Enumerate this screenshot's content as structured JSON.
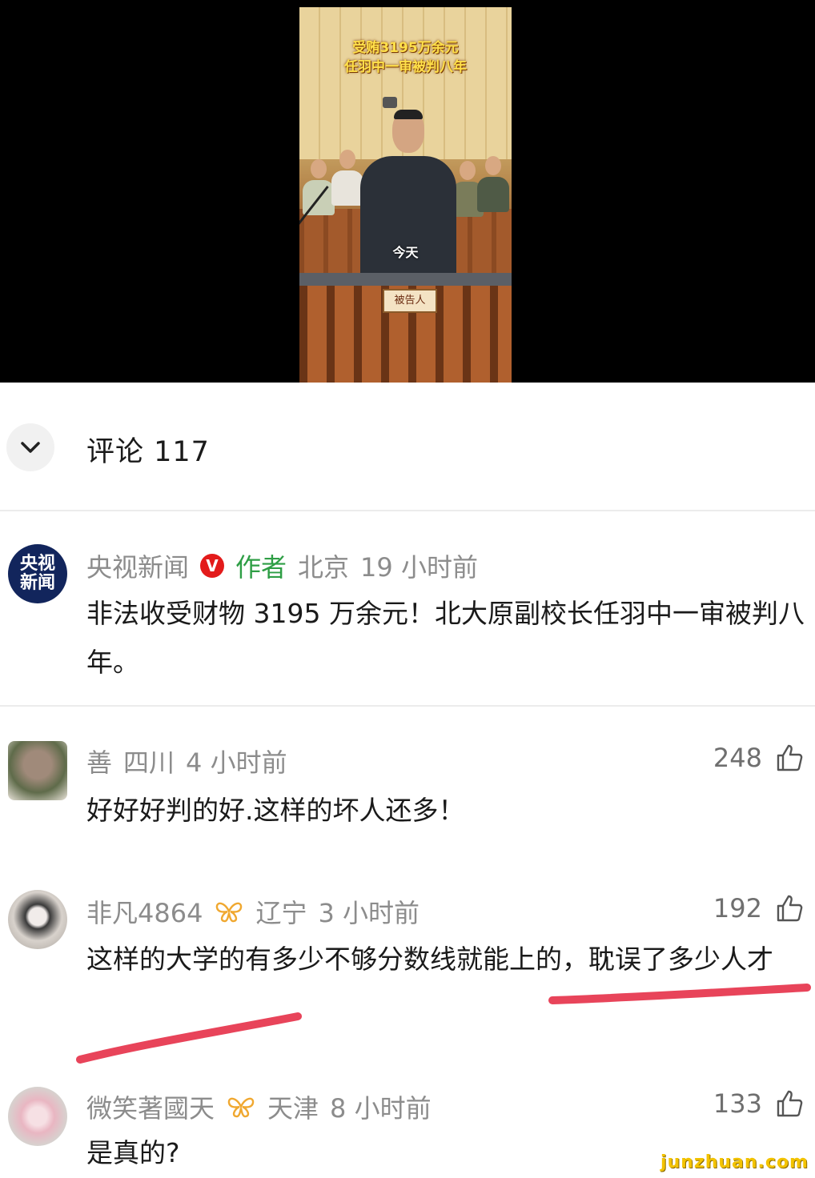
{
  "video": {
    "title_line1": "受贿3195万余元",
    "title_line2": "任羽中一审被判八年",
    "subtitle": "今天",
    "plaque": "被告人"
  },
  "comments_header": {
    "title": "评论 117"
  },
  "post": {
    "author": "央视新闻",
    "avatar_text_top": "央视",
    "avatar_text_bottom": "新闻",
    "verified_badge": "V",
    "author_tag": "作者",
    "location": "北京",
    "time": "19 小时前",
    "text": "非法收受财物 3195 万余元！北大原副校长任羽中一审被判八年。"
  },
  "comments": [
    {
      "user": "善",
      "location": "四川",
      "time": "4 小时前",
      "likes": "248",
      "text": "好好好判的好.这样的坏人还多！"
    },
    {
      "user": "非凡4864",
      "location": "辽宁",
      "time": "3 小时前",
      "likes": "192",
      "text": "这样的大学的有多少不够分数线就能上的，耽误了多少人才"
    },
    {
      "user": "微笑著國天",
      "location": "天津",
      "time": "8 小时前",
      "likes": "133",
      "text": "是真的?"
    }
  ],
  "colors": {
    "verified_badge": "#e31b1b",
    "author_tag": "#2e9e45",
    "underline": "#e8445a",
    "butterfly": "#f0a830",
    "watermark": "#f3c300"
  },
  "icons": [
    "chevron-down-icon",
    "thumbs-up-icon",
    "butterfly-badge-icon",
    "verified-v-icon"
  ],
  "watermark": "junzhuan.com"
}
